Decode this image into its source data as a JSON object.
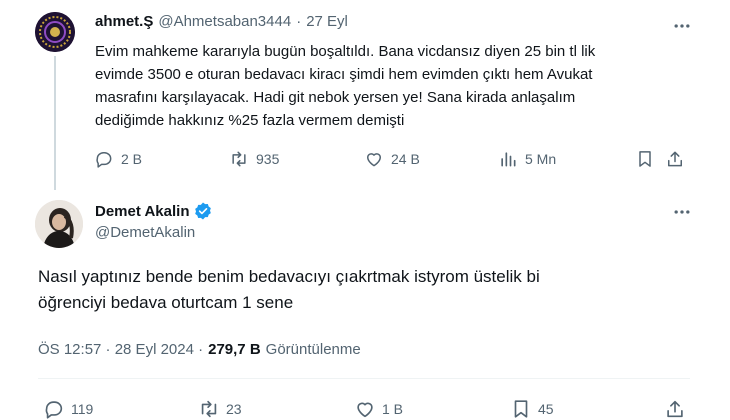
{
  "parent_tweet": {
    "display_name": "ahmet.Ş",
    "handle": "@Ahmetsaban3444",
    "separator": "·",
    "date": "27 Eyl",
    "text_lines": [
      "Evim mahkeme kararıyla bugün boşaltıldı. Bana vicdansız diyen 25 bin tl lik",
      "evimde 3500 e oturan bedavacı kiracı şimdi hem evimden çıktı hem Avukat",
      "masrafını karşılayacak. Hadi git nebok yersen ye! Sana kirada anlaşalım",
      "dediğimde hakkınız %25 fazla vermem demişti"
    ],
    "stats": {
      "replies": "2 B",
      "retweets": "935",
      "likes": "24 B",
      "views": "5 Mn"
    }
  },
  "main_tweet": {
    "display_name": "Demet Akalin",
    "handle": "@DemetAkalin",
    "verified": true,
    "text_lines": [
      "Nasıl yaptınız bende benim bedavacıyı çıakrtmak istyrom üstelik bi",
      "öğrenciyi bedava oturtcam 1 sene"
    ],
    "timestamp": "ÖS 12:57 · 28 Eyl 2024 ·",
    "views_count": "279,7 B",
    "views_label": "Görüntülenme",
    "stats": {
      "replies": "119",
      "retweets": "23",
      "likes": "1 B",
      "bookmarks": "45"
    }
  },
  "colors": {
    "text": "#0f1419",
    "muted": "#536471",
    "verified": "#1d9bf0",
    "divider": "#eff3f4",
    "thread_line": "#cfd9de"
  }
}
